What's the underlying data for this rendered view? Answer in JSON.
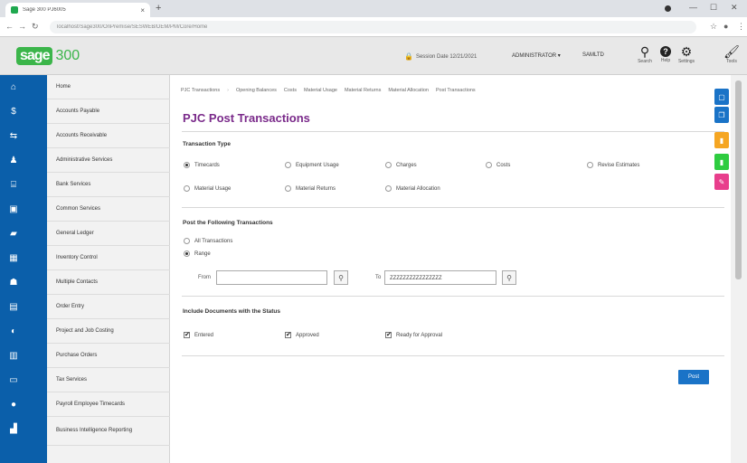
{
  "browser": {
    "tab_title": "Sage 300 PJ6005",
    "url": "localhost/Sage300/OnPremise/SESWEB/DEM/PM/Core/Home",
    "new_tab": "+",
    "tab_close": "×"
  },
  "header": {
    "logo_brand": "sage",
    "logo_version": "300",
    "session_date": "Session Date  12/21/2021",
    "user": "ADMINISTRATOR ▾",
    "company": "SAMLTD",
    "icons": [
      {
        "name": "search-icon",
        "label": "Search"
      },
      {
        "name": "help-icon",
        "label": "Help"
      },
      {
        "name": "settings-icon",
        "label": "Settings"
      },
      {
        "name": "tools-icon",
        "label": "Tools"
      }
    ]
  },
  "sidebar": {
    "items": [
      {
        "label": "Home",
        "icon": "home-icon"
      },
      {
        "label": "Accounts Payable",
        "icon": "accounts-payable-icon"
      },
      {
        "label": "Accounts Receivable",
        "icon": "accounts-receivable-icon"
      },
      {
        "label": "Administrative Services",
        "icon": "admin-services-icon"
      },
      {
        "label": "Bank Services",
        "icon": "bank-icon"
      },
      {
        "label": "Common Services",
        "icon": "common-services-icon"
      },
      {
        "label": "General Ledger",
        "icon": "general-ledger-icon"
      },
      {
        "label": "Inventory Control",
        "icon": "inventory-icon"
      },
      {
        "label": "Multiple Contacts",
        "icon": "contacts-icon"
      },
      {
        "label": "Order Entry",
        "icon": "order-entry-icon"
      },
      {
        "label": "Project and Job Costing",
        "icon": "project-job-icon"
      },
      {
        "label": "Purchase Orders",
        "icon": "purchase-orders-icon"
      },
      {
        "label": "Tax Services",
        "icon": "tax-icon"
      },
      {
        "label": "Payroll Employee Timecards",
        "icon": "payroll-icon"
      },
      {
        "label": "Business Intelligence Reporting",
        "icon": "bi-reporting-icon"
      }
    ]
  },
  "breadcrumbs": [
    "PJC Transactions",
    "Opening Balances",
    "Costs",
    "Material Usage",
    "Material Returns",
    "Material Allocation",
    "Post Transactions"
  ],
  "page": {
    "title": "PJC Post Transactions",
    "transaction_type": {
      "title": "Transaction Type",
      "options": [
        {
          "label": "Timecards",
          "selected": true
        },
        {
          "label": "Equipment Usage",
          "selected": false
        },
        {
          "label": "Charges",
          "selected": false
        },
        {
          "label": "Costs",
          "selected": false
        },
        {
          "label": "Revise Estimates",
          "selected": false
        },
        {
          "label": "Material Usage",
          "selected": false
        },
        {
          "label": "Material Returns",
          "selected": false
        },
        {
          "label": "Material Allocation",
          "selected": false
        }
      ]
    },
    "post_following": {
      "title": "Post the Following Transactions",
      "options": [
        {
          "label": "All Transactions",
          "selected": false
        },
        {
          "label": "Range",
          "selected": true
        }
      ],
      "from_label": "From",
      "from_value": "",
      "to_label": "To",
      "to_value": "ZZZZZZZZZZZZZZZZ"
    },
    "status": {
      "title": "Include Documents with the Status",
      "checks": [
        {
          "label": "Entered",
          "checked": true
        },
        {
          "label": "Approved",
          "checked": true
        },
        {
          "label": "Ready for Approval",
          "checked": true
        }
      ]
    },
    "post_button": "Post"
  },
  "side_tools": [
    {
      "name": "document-icon",
      "color": "#1a73c7"
    },
    {
      "name": "copy-icon",
      "color": "#1a73c7"
    },
    {
      "name": "file-icon",
      "color": "#f5a623"
    },
    {
      "name": "note-icon",
      "color": "#2ecc40"
    },
    {
      "name": "pen-icon",
      "color": "#e83e8c"
    }
  ],
  "colors": {
    "rail": "#0b5faa",
    "title": "#7a2a8a",
    "accent": "#1a73c7",
    "brand": "#3bb54a"
  }
}
